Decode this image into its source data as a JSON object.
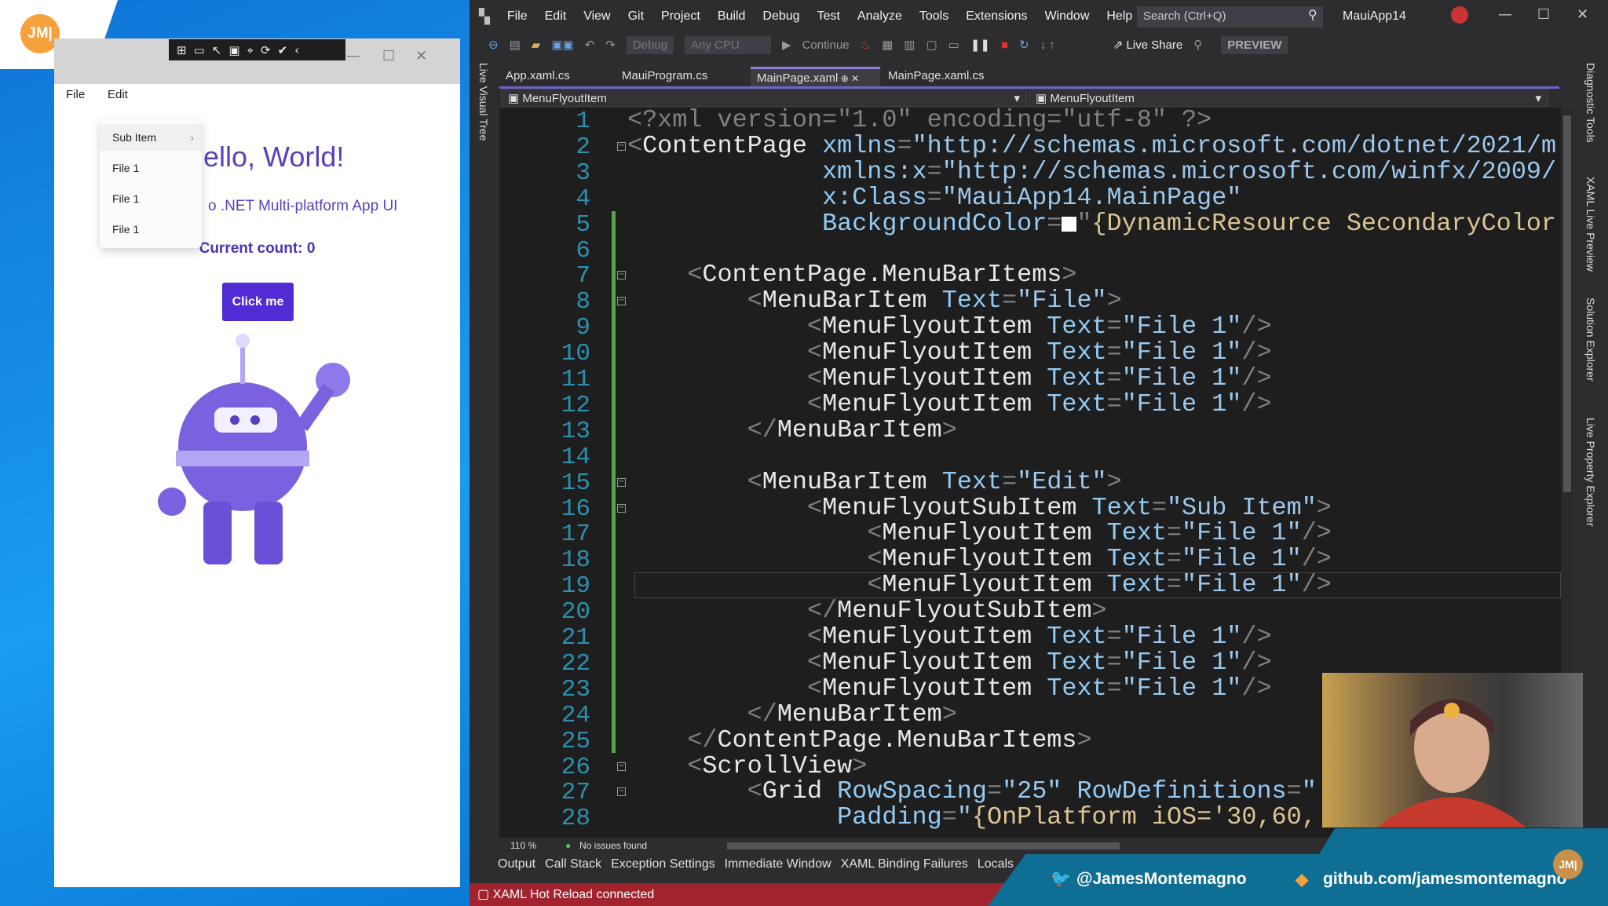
{
  "logo": {
    "text": "JM|",
    "color": "#f7a13b"
  },
  "app": {
    "menu": [
      "File",
      "Edit"
    ],
    "dropdown": [
      {
        "label": "Sub Item",
        "has_submenu": true
      },
      {
        "label": "File 1"
      },
      {
        "label": "File 1"
      },
      {
        "label": "File 1"
      }
    ],
    "hello": "ello, World!",
    "subtitle": "o .NET Multi-platform App UI",
    "count": "Current count: 0",
    "button": "Click me",
    "accent": "#512bd4"
  },
  "vs": {
    "menu": [
      "File",
      "Edit",
      "View",
      "Git",
      "Project",
      "Build",
      "Debug",
      "Test",
      "Analyze",
      "Tools",
      "Extensions",
      "Window",
      "Help"
    ],
    "search_placeholder": "Search (Ctrl+Q)",
    "solution": "MauiApp14",
    "toolbar": {
      "config": "Debug",
      "platform": "Any CPU",
      "continue": "Continue",
      "live_share": "Live Share",
      "preview": "PREVIEW"
    },
    "tabs": [
      {
        "label": "App.xaml.cs"
      },
      {
        "label": "MauiProgram.cs"
      },
      {
        "label": "MainPage.xaml",
        "active": true
      },
      {
        "label": "MainPage.xaml.cs"
      }
    ],
    "nav_left": "MenuFlyoutItem",
    "nav_right": "MenuFlyoutItem",
    "left_panel": "Live Visual Tree",
    "right_panels": [
      "Diagnostic Tools",
      "XAML Live Preview",
      "Solution Explorer",
      "Live Property Explorer"
    ],
    "zoom": "110 %",
    "issues": "No issues found",
    "tool_tabs": [
      "Output",
      "Call Stack",
      "Exception Settings",
      "Immediate Window",
      "XAML Binding Failures",
      "Locals"
    ],
    "status": "XAML Hot Reload connected",
    "current_line": 19,
    "code": [
      [
        [
          "d",
          "<?xml version=\"1.0\" encoding=\"utf-8\" ?>"
        ]
      ],
      [
        [
          "b",
          "<"
        ],
        [
          "e",
          "ContentPage "
        ],
        [
          "a",
          "xmlns"
        ],
        [
          "b",
          "="
        ],
        [
          "v",
          "\"http://schemas.microsoft.com/dotnet/2021/m"
        ]
      ],
      [
        [
          "e",
          "             "
        ],
        [
          "a",
          "xmlns:x"
        ],
        [
          "b",
          "="
        ],
        [
          "v",
          "\"http://schemas.microsoft.com/winfx/2009/"
        ]
      ],
      [
        [
          "e",
          "             "
        ],
        [
          "a",
          "x:Class"
        ],
        [
          "b",
          "="
        ],
        [
          "v",
          "\"MauiApp14.MainPage\""
        ]
      ],
      [
        [
          "e",
          "             "
        ],
        [
          "a",
          "BackgroundColor"
        ],
        [
          "b",
          "="
        ],
        [
          "sw",
          ""
        ],
        [
          "b",
          "\""
        ],
        [
          "r",
          "{DynamicResource SecondaryColor"
        ]
      ],
      [],
      [
        [
          "e",
          "    "
        ],
        [
          "b",
          "<"
        ],
        [
          "e",
          "ContentPage.MenuBarItems"
        ],
        [
          "b",
          ">"
        ]
      ],
      [
        [
          "e",
          "        "
        ],
        [
          "b",
          "<"
        ],
        [
          "e",
          "MenuBarItem "
        ],
        [
          "a",
          "Text"
        ],
        [
          "b",
          "="
        ],
        [
          "v",
          "\"File\""
        ],
        [
          "b",
          ">"
        ]
      ],
      [
        [
          "e",
          "            "
        ],
        [
          "b",
          "<"
        ],
        [
          "e",
          "MenuFlyoutItem "
        ],
        [
          "a",
          "Text"
        ],
        [
          "b",
          "="
        ],
        [
          "v",
          "\"File 1\""
        ],
        [
          "b",
          "/>"
        ]
      ],
      [
        [
          "e",
          "            "
        ],
        [
          "b",
          "<"
        ],
        [
          "e",
          "MenuFlyoutItem "
        ],
        [
          "a",
          "Text"
        ],
        [
          "b",
          "="
        ],
        [
          "v",
          "\"File 1\""
        ],
        [
          "b",
          "/>"
        ]
      ],
      [
        [
          "e",
          "            "
        ],
        [
          "b",
          "<"
        ],
        [
          "e",
          "MenuFlyoutItem "
        ],
        [
          "a",
          "Text"
        ],
        [
          "b",
          "="
        ],
        [
          "v",
          "\"File 1\""
        ],
        [
          "b",
          "/>"
        ]
      ],
      [
        [
          "e",
          "            "
        ],
        [
          "b",
          "<"
        ],
        [
          "e",
          "MenuFlyoutItem "
        ],
        [
          "a",
          "Text"
        ],
        [
          "b",
          "="
        ],
        [
          "v",
          "\"File 1\""
        ],
        [
          "b",
          "/>"
        ]
      ],
      [
        [
          "e",
          "        "
        ],
        [
          "b",
          "</"
        ],
        [
          "e",
          "MenuBarItem"
        ],
        [
          "b",
          ">"
        ]
      ],
      [],
      [
        [
          "e",
          "        "
        ],
        [
          "b",
          "<"
        ],
        [
          "e",
          "MenuBarItem "
        ],
        [
          "a",
          "Text"
        ],
        [
          "b",
          "="
        ],
        [
          "v",
          "\"Edit\""
        ],
        [
          "b",
          ">"
        ]
      ],
      [
        [
          "e",
          "            "
        ],
        [
          "b",
          "<"
        ],
        [
          "e",
          "MenuFlyoutSubItem "
        ],
        [
          "a",
          "Text"
        ],
        [
          "b",
          "="
        ],
        [
          "v",
          "\"Sub Item\""
        ],
        [
          "b",
          ">"
        ]
      ],
      [
        [
          "e",
          "                "
        ],
        [
          "b",
          "<"
        ],
        [
          "e",
          "MenuFlyoutItem "
        ],
        [
          "a",
          "Text"
        ],
        [
          "b",
          "="
        ],
        [
          "v",
          "\"File 1\""
        ],
        [
          "b",
          "/>"
        ]
      ],
      [
        [
          "e",
          "                "
        ],
        [
          "b",
          "<"
        ],
        [
          "e",
          "MenuFlyoutItem "
        ],
        [
          "a",
          "Text"
        ],
        [
          "b",
          "="
        ],
        [
          "v",
          "\"File 1\""
        ],
        [
          "b",
          "/>"
        ]
      ],
      [
        [
          "e",
          "                "
        ],
        [
          "b",
          "<"
        ],
        [
          "e",
          "MenuFlyoutItem "
        ],
        [
          "a",
          "Text"
        ],
        [
          "b",
          "="
        ],
        [
          "v",
          "\"File 1\""
        ],
        [
          "b",
          "/>"
        ]
      ],
      [
        [
          "e",
          "            "
        ],
        [
          "b",
          "</"
        ],
        [
          "e",
          "MenuFlyoutSubItem"
        ],
        [
          "b",
          ">"
        ]
      ],
      [
        [
          "e",
          "            "
        ],
        [
          "b",
          "<"
        ],
        [
          "e",
          "MenuFlyoutItem "
        ],
        [
          "a",
          "Text"
        ],
        [
          "b",
          "="
        ],
        [
          "v",
          "\"File 1\""
        ],
        [
          "b",
          "/>"
        ]
      ],
      [
        [
          "e",
          "            "
        ],
        [
          "b",
          "<"
        ],
        [
          "e",
          "MenuFlyoutItem "
        ],
        [
          "a",
          "Text"
        ],
        [
          "b",
          "="
        ],
        [
          "v",
          "\"File 1\""
        ],
        [
          "b",
          "/>"
        ]
      ],
      [
        [
          "e",
          "            "
        ],
        [
          "b",
          "<"
        ],
        [
          "e",
          "MenuFlyoutItem "
        ],
        [
          "a",
          "Text"
        ],
        [
          "b",
          "="
        ],
        [
          "v",
          "\"File 1\""
        ],
        [
          "b",
          "/>"
        ]
      ],
      [
        [
          "e",
          "        "
        ],
        [
          "b",
          "</"
        ],
        [
          "e",
          "MenuBarItem"
        ],
        [
          "b",
          ">"
        ]
      ],
      [
        [
          "e",
          "    "
        ],
        [
          "b",
          "</"
        ],
        [
          "e",
          "ContentPage.MenuBarItems"
        ],
        [
          "b",
          ">"
        ]
      ],
      [
        [
          "e",
          "    "
        ],
        [
          "b",
          "<"
        ],
        [
          "e",
          "ScrollView"
        ],
        [
          "b",
          ">"
        ]
      ],
      [
        [
          "e",
          "        "
        ],
        [
          "b",
          "<"
        ],
        [
          "e",
          "Grid "
        ],
        [
          "a",
          "RowSpacing"
        ],
        [
          "b",
          "="
        ],
        [
          "v",
          "\"25\" "
        ],
        [
          "a",
          "RowDefinitions"
        ],
        [
          "b",
          "="
        ],
        [
          "v",
          "\""
        ]
      ],
      [
        [
          "e",
          "              "
        ],
        [
          "a",
          "Padding"
        ],
        [
          "b",
          "="
        ],
        [
          "v",
          "\""
        ],
        [
          "r",
          "{OnPlatform iOS='30,60,"
        ]
      ]
    ],
    "fold_lines": [
      2,
      7,
      8,
      15,
      16,
      26,
      27
    ]
  },
  "social": {
    "twitter": "@JamesMontemagno",
    "github": "github.com/jamesmontemagno",
    "banner_color": "#0f6e93"
  }
}
